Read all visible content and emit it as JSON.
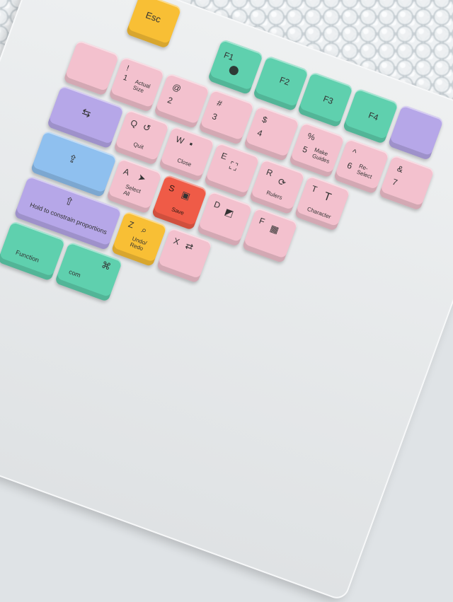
{
  "keys": {
    "esc": "Esc",
    "f1": "F1",
    "f2": "F2",
    "f3": "F3",
    "f4": "F4",
    "k1_top": "!",
    "k1_main": "1",
    "k1_desc": "Actual\nSize",
    "k2_top": "@",
    "k2_main": "2",
    "k3_top": "#",
    "k3_main": "3",
    "k4_top": "$",
    "k4_main": "4",
    "k5_top": "%",
    "k5_main": "5",
    "k5_desc": "Make\nGuides",
    "k6_top": "^",
    "k6_main": "6",
    "k6_desc": "Re-\nSelect",
    "k7_top": "&",
    "k7_main": "7",
    "q_main": "Q",
    "q_desc": "Quit",
    "w_main": "W",
    "w_desc": "Close",
    "e_main": "E",
    "r_main": "R",
    "r_desc": "Rulers",
    "t_main": "T",
    "t_desc": "Character",
    "a_main": "A",
    "a_desc": "Select\nAll",
    "s_main": "S",
    "s_desc": "Save",
    "d_main": "D",
    "f_main": "F",
    "z_main": "Z",
    "z_desc": "Undo/\nRedo",
    "x_main": "X",
    "shift_desc": "Hold to constrain proportions",
    "function_desc": "Function",
    "cmd_desc": "com"
  },
  "icons": {
    "f1": "help-circle-icon",
    "tab": "tab-arrows-icon",
    "caps": "caps-lock-icon",
    "shift": "shift-arrow-icon",
    "quit": "quit-icon",
    "close": "close-window-icon",
    "e": "brush-select-icon",
    "r": "refresh-icon",
    "t": "type-tool-icon",
    "a": "cursor-icon",
    "s": "save-image-icon",
    "d": "default-colors-icon",
    "f": "frame-icon",
    "z": "search-icon",
    "x": "swap-icon",
    "cmd": "command-icon"
  },
  "colors": {
    "pink": "#f3c1ce",
    "mint": "#5fd0ae",
    "yellow": "#f8bf35",
    "violet": "#b6a7e8",
    "blue": "#8fc0ef",
    "red": "#ef5b47"
  }
}
